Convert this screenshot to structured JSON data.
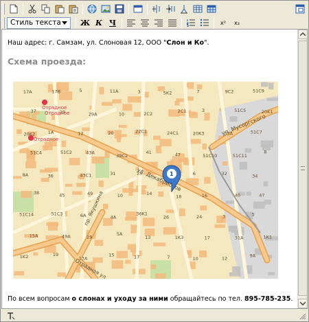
{
  "toolbar": {
    "style_select": {
      "value": "Стиль текста"
    },
    "bold_label": "Ж",
    "italic_label": "К",
    "underline_label": "Ч",
    "superscript_label": "x²",
    "subscript_label": "x₂"
  },
  "content": {
    "address_prefix": "Наш адрес: г. Самзам, ул. Слоновая 12, ООО \"",
    "address_company": "Слон и Ко",
    "address_suffix": "\".",
    "heading": "Схема проезда:",
    "footer_prefix": "По всем вопросам ",
    "footer_bold": "о слонах и уходу за ними",
    "footer_middle": " обращайтесь по тел. ",
    "footer_phone": "895-785-235",
    "footer_suffix": "."
  },
  "map": {
    "street_labels": [
      "ул. Декабристов",
      "ул. Мусоргского",
      "пр. Якушкина",
      "Отрадная ул."
    ],
    "metro_labels": [
      "Отрадное",
      "Отрадное",
      "Отрадное"
    ],
    "marker_number": "1",
    "house_labels": [
      "17A",
      "17B",
      "5",
      "11A",
      "3",
      "5K2",
      "7",
      "9C2",
      "51C9",
      "37",
      "29",
      "29A",
      "10",
      "2C2",
      "2C1",
      "3",
      "51C5",
      "20K1",
      "20K2",
      "1A",
      "12",
      "20",
      "22C1",
      "24C1",
      "20K3",
      "35A",
      "51C7",
      "51C4",
      "51C2",
      "43A",
      "39C2",
      "41",
      "47",
      "51C10",
      "51C11",
      "8",
      "8A",
      "36",
      "43C1",
      "31",
      "28",
      "4",
      "6",
      "32",
      "34",
      "38",
      "45",
      "49",
      "10",
      "14",
      "18",
      "16",
      "40",
      "47",
      "51C14",
      "51C3",
      "6A",
      "4A",
      "36K1",
      "26",
      "24",
      "3",
      "5",
      "15A",
      "49A",
      "29",
      "5A",
      "13",
      "1K3",
      "17",
      "31A",
      "1K1",
      "1K2",
      "19",
      "13A",
      "15",
      "17",
      "7",
      "10",
      "12",
      "9A"
    ],
    "colors": {
      "ground": "#f5e7be",
      "road": "#f3b872",
      "street": "#fff6dc",
      "building": "#f2b97d",
      "industrial": "#d9d9d9",
      "park": "#c9e0a6",
      "metro": "#e0344b"
    }
  },
  "colors": {
    "window_bg": "#ece9d8",
    "heading": "#8a8a8a",
    "icon_blue": "#2a5ea8"
  }
}
